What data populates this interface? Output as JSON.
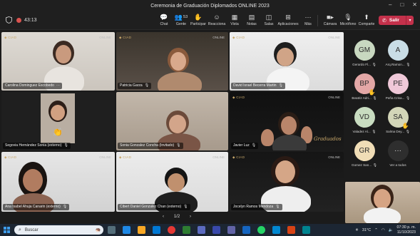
{
  "window": {
    "title": "Ceremonia de Graduación Diplomados ONLINE 2023",
    "controls": [
      "–",
      "□",
      "✕"
    ]
  },
  "toolbar": {
    "timer": "43:13",
    "buttons": [
      {
        "label": "Chat",
        "icon": "chat-icon"
      },
      {
        "label": "Gente",
        "icon": "people-icon",
        "count": "53"
      },
      {
        "label": "Participar",
        "icon": "raise-hand-icon"
      },
      {
        "label": "Reacciona",
        "icon": "react-icon"
      },
      {
        "label": "Vista",
        "icon": "view-icon"
      },
      {
        "label": "Notas",
        "icon": "notes-icon"
      },
      {
        "label": "Salas",
        "icon": "rooms-icon"
      },
      {
        "label": "Aplicaciones",
        "icon": "apps-icon"
      },
      {
        "label": "Más",
        "icon": "more-icon"
      },
      {
        "label": "Cámara",
        "icon": "camera-icon"
      },
      {
        "label": "Micrófono",
        "icon": "mic-off-icon"
      },
      {
        "label": "Comparte",
        "icon": "share-icon"
      }
    ],
    "leave_label": "Salir"
  },
  "tiles": [
    {
      "name": "Carolina Dominguez Escobedo",
      "brand": "ONLINE"
    },
    {
      "name": "Patricia Garza",
      "brand": "ONLINE"
    },
    {
      "name": "David Israel Becerra Martin",
      "brand": "ONLINE"
    },
    {
      "name": "Segovia Hernández Sonia (externo)",
      "brand": ""
    },
    {
      "name": "Sonia Gonzalez Concha (Invitado)",
      "brand": ""
    },
    {
      "name": "Javier Luz",
      "brand": "ONLINE"
    },
    {
      "name": "Ana Isabel Ahuja Canarin (externo)",
      "brand": "ONLINE"
    },
    {
      "name": "Cibert Daniel Gonzalez Chan (externo)",
      "brand": "ONLINE"
    },
    {
      "name": "Jocelyn Ramos Mendoza",
      "brand": "ONLINE"
    }
  ],
  "side_participants": [
    {
      "initials": "GM",
      "name": "Gerardo Fl...",
      "color": "#c8d8c0"
    },
    {
      "initials": "A",
      "name": "Arq.Ramon...",
      "color": "#c9dde6"
    },
    {
      "initials": "BP",
      "name": "Beatriz Adri...",
      "color": "#e3a7a6",
      "hand": true
    },
    {
      "initials": "PE",
      "name": "Peña Crisa...",
      "color": "#efc8d8"
    },
    {
      "initials": "VD",
      "name": "Valadez Al...",
      "color": "#c8dcc0"
    },
    {
      "initials": "SA",
      "name": "Salma Dey...",
      "color": "#d3d6b8",
      "hand": true
    },
    {
      "initials": "GR",
      "name": "Gomez San...",
      "color": "#f0ddb6"
    },
    {
      "initials": "",
      "name": "Ver a todos",
      "color": "#2e2e2e",
      "more": true
    }
  ],
  "pager": {
    "label": "1/2",
    "prev": "‹",
    "next": "›"
  },
  "taskbar": {
    "search_placeholder": "Buscar",
    "weather": "31°C",
    "time": "07:30 p. m.",
    "date": "11/10/2023"
  },
  "colors": {
    "leave": "#c4314b",
    "accent": "#c9a86a",
    "taskbar": "#1c2633"
  }
}
